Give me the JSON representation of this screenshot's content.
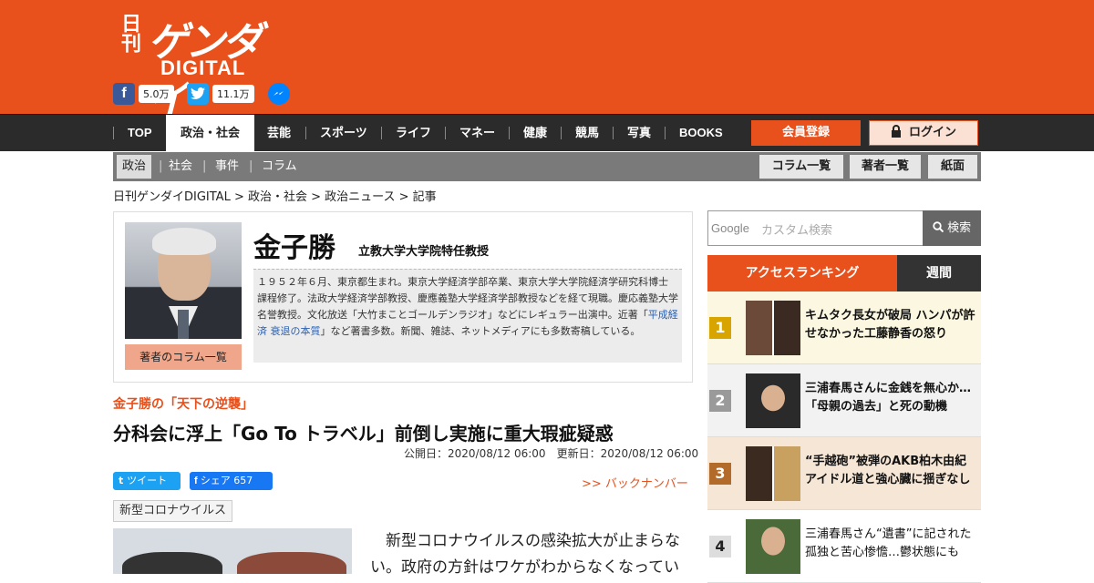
{
  "header": {
    "logo_kanji": "日刊",
    "logo_main": "ゲンダイ",
    "logo_sub": "DIGITAL",
    "facebook_count": "5.0万",
    "twitter_count": "11.1万"
  },
  "nav": {
    "items": [
      "TOP",
      "政治・社会",
      "芸能",
      "スポーツ",
      "ライフ",
      "マネー",
      "健康",
      "競馬",
      "写真",
      "BOOKS"
    ],
    "register": "会員登録",
    "login": "ログイン"
  },
  "subnav": {
    "items": [
      "政治",
      "社会",
      "事件",
      "コラム"
    ],
    "buttons": [
      "コラム一覧",
      "著者一覧",
      "紙面"
    ]
  },
  "breadcrumb": "日刊ゲンダイDIGITAL > 政治・社会 > 政治ニュース > 記事",
  "author": {
    "name": "金子勝",
    "title": "立教大学大学院特任教授",
    "column_button": "著者のコラム一覧",
    "bio_1": "１９５２年６月、東京都生まれ。東京大学経済学部卒業、東京大学大学院経済学研究科博士課程修了。法政大学経済学部教授、慶應義塾大学経済学部教授などを経て現職。慶応義塾大学名誉教授。文化放送「大竹まことゴールデンラジオ」などにレギュラー出演中。近著「",
    "bio_link": "平成経済 衰退の本質",
    "bio_2": "」など著書多数。新聞、雑誌、ネットメディアにも多数寄稿している。"
  },
  "article": {
    "series": "金子勝の「天下の逆襲」",
    "headline": "分科会に浮上「Go To トラベル」前倒し実施に重大瑕疵疑惑",
    "published": "公開日：2020/08/12 06:00",
    "updated": "更新日：2020/08/12 06:00",
    "tweet": "ツイート",
    "share": "シェア 657",
    "backnumber": ">> バックナンバー",
    "tag": "新型コロナウイルス",
    "body": "　新型コロナウイルスの感染拡大が止まらない。政府の方針はワケがわからなくなってい"
  },
  "sidebar": {
    "search_brand": "Google",
    "search_placeholder": "カスタム検索",
    "search_button": "検索",
    "tab_ranking": "アクセスランキング",
    "tab_weekly": "週間",
    "ranking": [
      {
        "num": "1",
        "text": "キムタク長女が破局 ハンパが許せなかった工藤静香の怒り"
      },
      {
        "num": "2",
        "text": "三浦春馬さんに金銭を無心か…「母親の過去」と死の動機"
      },
      {
        "num": "3",
        "text": "“手越砲”被弾のAKB柏木由紀 アイドル道と強心臓に揺ぎなし"
      },
      {
        "num": "4",
        "text": "三浦春馬さん“遺書”に記された孤独と苦心惨憺…鬱状態にも"
      }
    ]
  },
  "colors": {
    "brand": "#e8501c",
    "nav_bg": "#2b2b2b",
    "rank1": "#d8a400",
    "rank2": "#9a9a9a",
    "rank3": "#b26b2a",
    "rank_other": "#dddddd"
  }
}
